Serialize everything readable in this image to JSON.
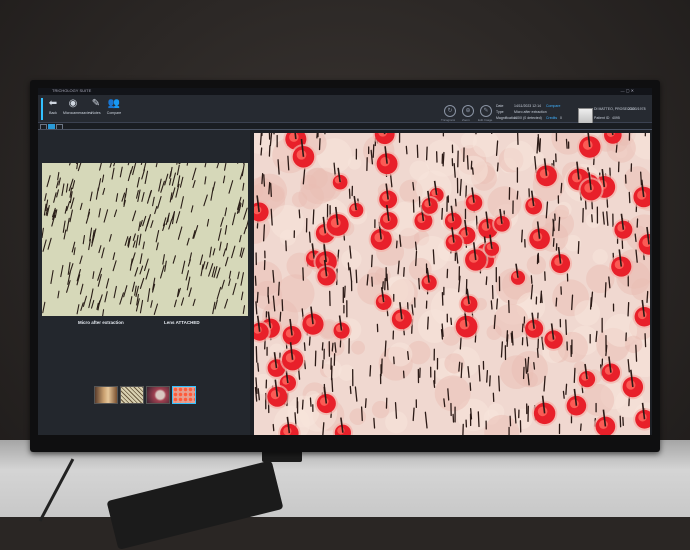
{
  "app": {
    "title": "TRICHOLOGY SUITE",
    "window_controls": "— ▢ ✕"
  },
  "toolbar": {
    "items": [
      {
        "label": "Back",
        "icon": "back-arrow-icon",
        "glyph": "⬅"
      },
      {
        "label": "Microcameraaview",
        "icon": "camera-lens-icon",
        "glyph": "◉"
      },
      {
        "label": "Notes",
        "icon": "notes-icon",
        "glyph": "✎"
      },
      {
        "label": "Compare",
        "icon": "people-icon",
        "glyph": "👥"
      }
    ],
    "tools": [
      {
        "icon": "rotate-icon",
        "glyph": "↻",
        "label": "Tricogrami"
      },
      {
        "icon": "zoom-icon",
        "glyph": "⊕",
        "label": "Zoom"
      },
      {
        "icon": "edit-icon",
        "glyph": "✎",
        "label": "Edit Image"
      }
    ],
    "image_info": {
      "date_label": "Date",
      "date_value": "14/11/2023 12:14",
      "type_label": "Type",
      "type_value": "Micro after extraction",
      "magnification_label": "Magnification",
      "magnification_value": "100X (0 detected)",
      "link1": "Compare",
      "link2": "Credits",
      "link2_value": "0"
    },
    "patient": {
      "name": "DI MATTEO, PROSECCO",
      "date": "23/03/1978",
      "id_label": "Patient ID",
      "id_value": "4095"
    }
  },
  "left_panel": {
    "caption_left": "Micro after extraction",
    "caption_right": "Lens ATTACHED",
    "thumbnails": [
      {
        "name": "thumbnail-1",
        "selected": false,
        "color": "#c9a070"
      },
      {
        "name": "thumbnail-2",
        "selected": false,
        "color": "#d8d0b0"
      },
      {
        "name": "thumbnail-3",
        "selected": false,
        "color": "#a04050"
      },
      {
        "name": "thumbnail-4",
        "selected": true,
        "color": "#e08070"
      }
    ]
  },
  "colors": {
    "accent": "#33c1ff",
    "panel": "#23272d",
    "toolbar": "#262a31"
  }
}
